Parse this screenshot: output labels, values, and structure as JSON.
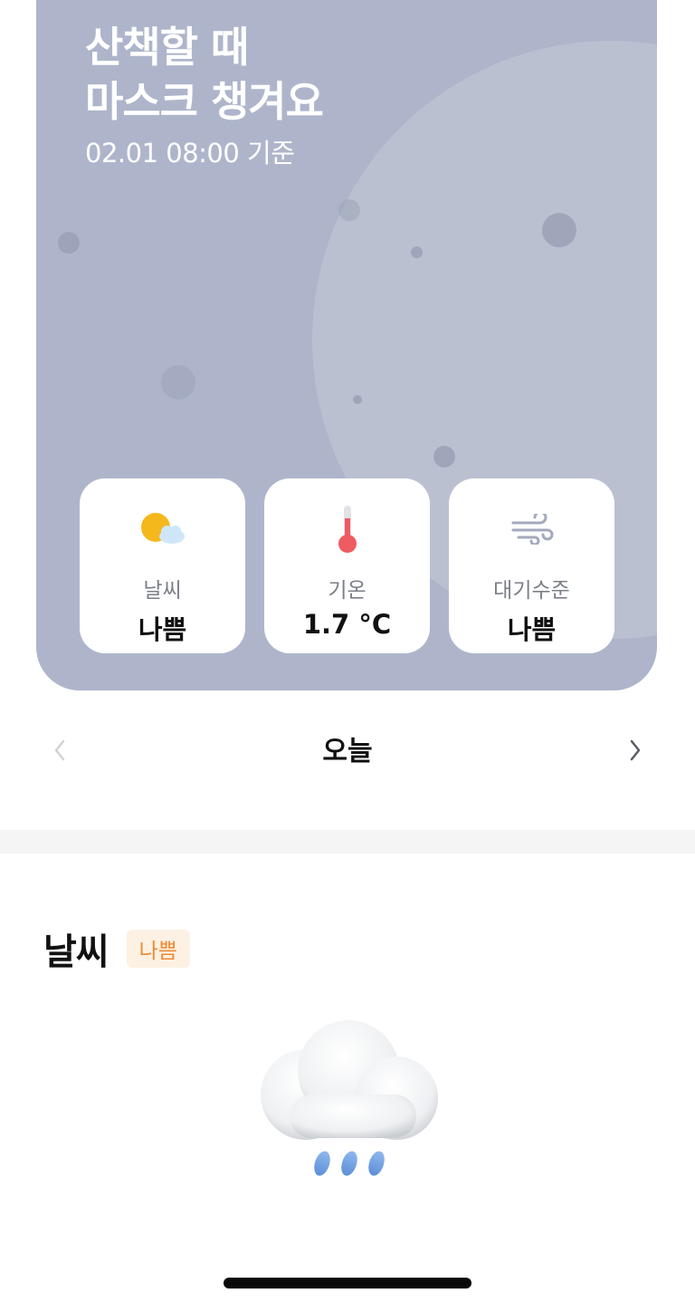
{
  "hero": {
    "title_line1": "산책할 때",
    "title_line2": "마스크 챙겨요",
    "timestamp": "02.01 08:00 기준",
    "background_color": "#aeb5cb"
  },
  "cards": [
    {
      "icon": "sun-cloud-icon",
      "label": "날씨",
      "value": "나쁨"
    },
    {
      "icon": "thermometer-icon",
      "label": "기온",
      "value": "1.7 °C"
    },
    {
      "icon": "wind-icon",
      "label": "대기수준",
      "value": "나쁨"
    }
  ],
  "date_nav": {
    "title": "오늘",
    "prev_icon": "chevron-left-icon",
    "next_icon": "chevron-right-icon"
  },
  "weather_section": {
    "title": "날씨",
    "badge": "나쁨",
    "badge_color": "#ef8a36",
    "illustration": "rain-cloud-icon"
  }
}
